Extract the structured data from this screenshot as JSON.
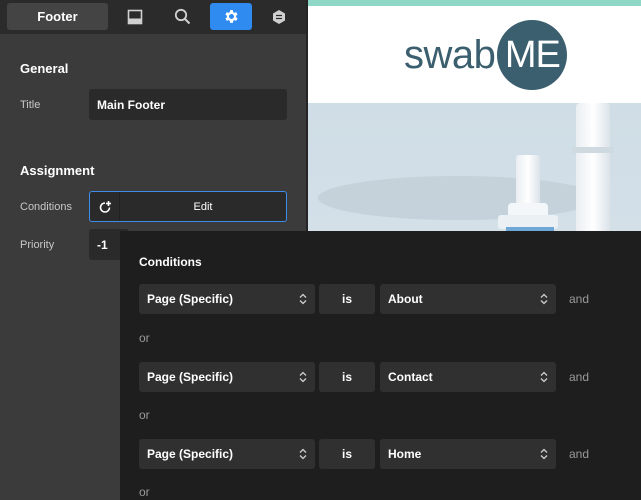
{
  "toolbar": {
    "footer_tab_label": "Footer"
  },
  "general": {
    "heading": "General",
    "title_label": "Title",
    "title_value": "Main Footer"
  },
  "assignment": {
    "heading": "Assignment",
    "conditions_label": "Conditions",
    "edit_label": "Edit",
    "priority_label": "Priority",
    "priority_value": "-1"
  },
  "preview": {
    "logo_text": "swab",
    "logo_circle_text": "ME",
    "topbar_color": "#8fd8c8",
    "logo_color": "#3b5f6e"
  },
  "conditions_popover": {
    "title": "Conditions",
    "rows": [
      {
        "type": "Page (Specific)",
        "operator": "is",
        "value": "About",
        "and_label": "and"
      },
      {
        "type": "Page (Specific)",
        "operator": "is",
        "value": "Contact",
        "and_label": "and"
      },
      {
        "type": "Page (Specific)",
        "operator": "is",
        "value": "Home",
        "and_label": "and"
      }
    ],
    "or_labels": [
      "or",
      "or",
      "or"
    ]
  },
  "colors": {
    "accent": "#2f8bf0",
    "panel_bg": "#3b3b3b",
    "popover_bg": "#1e1e1e"
  }
}
